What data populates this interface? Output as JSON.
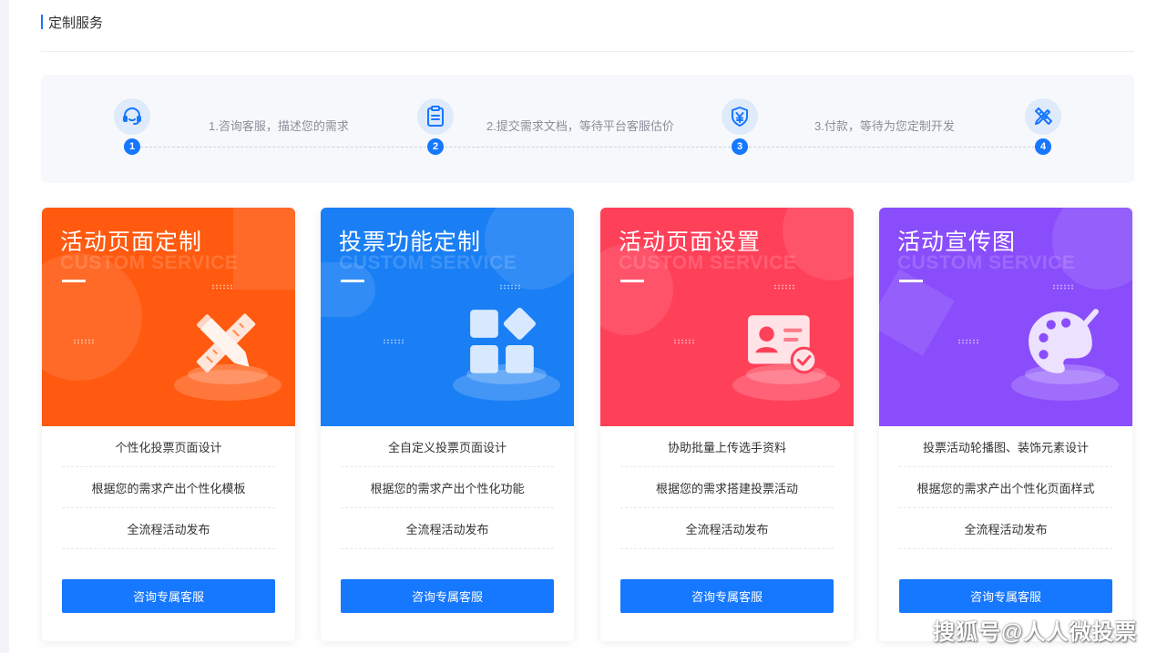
{
  "section": {
    "title": "定制服务"
  },
  "steps": {
    "items": [
      {
        "num": "1",
        "icon": "headset-icon"
      },
      {
        "num": "2",
        "icon": "clipboard-icon"
      },
      {
        "num": "3",
        "icon": "yuan-shield-icon"
      },
      {
        "num": "4",
        "icon": "design-tools-icon"
      }
    ],
    "connectors": [
      "1.咨询客服，描述您的需求",
      "2.提交需求文档，等待平台客服估价",
      "3.付款，等待为您定制开发"
    ]
  },
  "cards": [
    {
      "title": "活动页面定制",
      "subtitle": "CUSTOM SERVICE",
      "color": "#ff5a10",
      "icon": "pencil-ruler-icon",
      "features": [
        "个性化投票页面设计",
        "根据您的需求产出个性化模板",
        "全流程活动发布"
      ],
      "button": "咨询专属客服"
    },
    {
      "title": "投票功能定制",
      "subtitle": "CUSTOM SERVICE",
      "color": "#1a7ff5",
      "icon": "app-blocks-icon",
      "features": [
        "全自定义投票页面设计",
        "根据您的需求产出个性化功能",
        "全流程活动发布"
      ],
      "button": "咨询专属客服"
    },
    {
      "title": "活动页面设置",
      "subtitle": "CUSTOM SERVICE",
      "color": "#ff4059",
      "icon": "id-card-check-icon",
      "features": [
        "协助批量上传选手资料",
        "根据您的需求搭建投票活动",
        "全流程活动发布"
      ],
      "button": "咨询专属客服"
    },
    {
      "title": "活动宣传图",
      "subtitle": "CUSTOM SERVICE",
      "color": "#8a4dfb",
      "icon": "palette-icon",
      "features": [
        "投票活动轮播图、装饰元素设计",
        "根据您的需求产出个性化页面样式",
        "全流程活动发布"
      ],
      "button": "咨询专属客服"
    }
  ],
  "watermark": "搜狐号@人人微投票"
}
